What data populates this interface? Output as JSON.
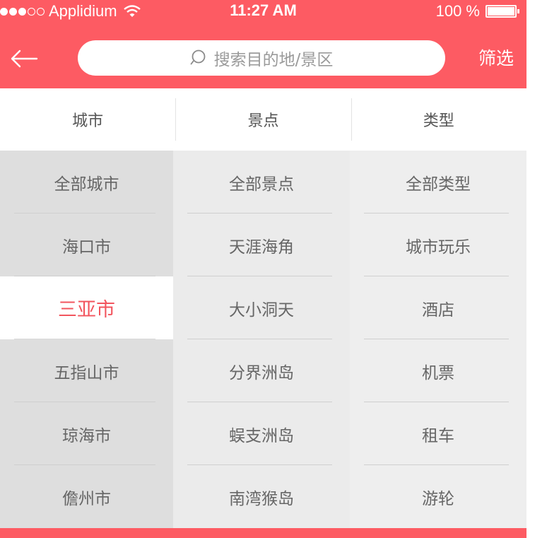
{
  "status_bar": {
    "carrier": "Applidium",
    "time": "11:27 AM",
    "battery": "100 %",
    "signal_dots_filled": 3,
    "signal_dots_total": 5
  },
  "header": {
    "back_icon": "arrow-left-icon",
    "search_placeholder": "搜索目的地/景区",
    "search_icon": "search-icon",
    "filter_label": "筛选"
  },
  "tabs": [
    {
      "label": "城市"
    },
    {
      "label": "景点"
    },
    {
      "label": "类型"
    }
  ],
  "cities": [
    {
      "label": "全部城市"
    },
    {
      "label": "海口市"
    },
    {
      "label": "三亚市",
      "selected": true
    },
    {
      "label": "五指山市"
    },
    {
      "label": "琼海市"
    },
    {
      "label": "儋州市"
    }
  ],
  "spots": [
    {
      "label": "全部景点"
    },
    {
      "label": "天涯海角"
    },
    {
      "label": "大小洞天"
    },
    {
      "label": "分界洲岛"
    },
    {
      "label": "蜈支洲岛"
    },
    {
      "label": "南湾猴岛"
    }
  ],
  "types": [
    {
      "label": "全部类型"
    },
    {
      "label": "城市玩乐"
    },
    {
      "label": "酒店"
    },
    {
      "label": "机票"
    },
    {
      "label": "租车"
    },
    {
      "label": "游轮"
    }
  ],
  "colors": {
    "brand": "#fd5b63",
    "selected_text": "#f2555e",
    "city_bg": "#dedede",
    "spot_bg": "#ebebeb",
    "type_bg": "#eeeeee"
  }
}
